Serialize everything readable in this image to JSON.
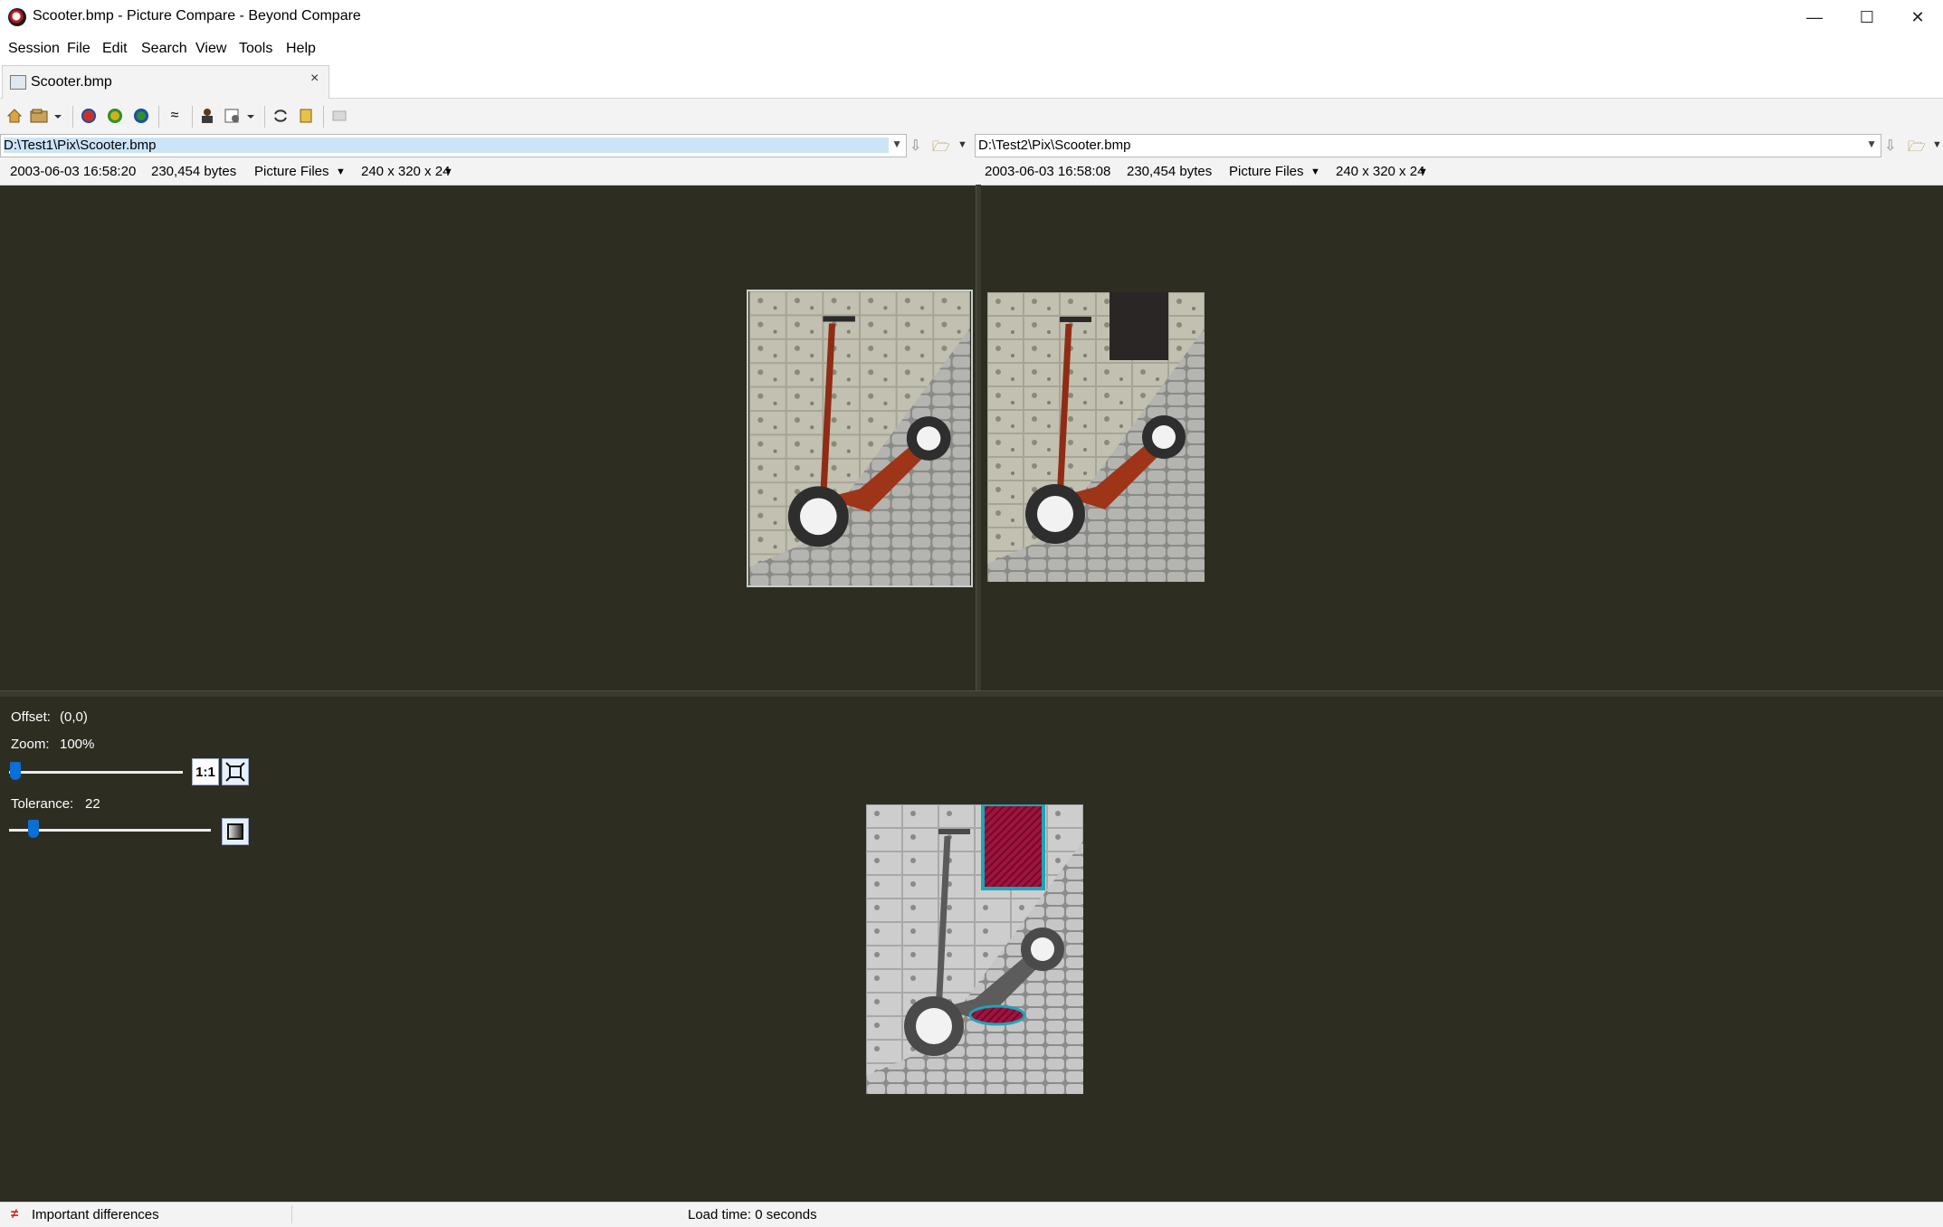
{
  "window": {
    "title": "Scooter.bmp - Picture Compare - Beyond Compare",
    "minimize_glyph": "—",
    "maximize_glyph": "☐",
    "close_glyph": "✕"
  },
  "menu": [
    "Session",
    "File",
    "Edit",
    "Search",
    "View",
    "Tools",
    "Help"
  ],
  "tab": {
    "label": "Scooter.bmp",
    "close_glyph": "×"
  },
  "toolbar": {
    "icons": [
      "home-icon",
      "open-session-icon",
      "show-all-icon",
      "show-differences-icon",
      "show-same-icon",
      "tolerance-icon",
      "rules-icon",
      "options-icon",
      "swap-sides-icon",
      "reload-icon",
      "edit-icon"
    ],
    "approx_glyph": "≈"
  },
  "left": {
    "path": "D:\\Test1\\Pix\\Scooter.bmp",
    "date": "2003-06-03 16:58:20",
    "size": "230,454 bytes",
    "format": "Picture Files",
    "dimensions": "240 x 320 x 24"
  },
  "right": {
    "path": "D:\\Test2\\Pix\\Scooter.bmp",
    "date": "2003-06-03 16:58:08",
    "size": "230,454 bytes",
    "format": "Picture Files",
    "dimensions": "240 x 320 x 24"
  },
  "controls": {
    "offset_label": "Offset:",
    "offset_value": "(0,0)",
    "zoom_label": "Zoom:",
    "zoom_value": "100%",
    "zoom_slider_level": 0.02,
    "one_to_one_label": "1:1",
    "tolerance_label": "Tolerance:",
    "tolerance_value": "22",
    "tolerance_slider_level": 0.1
  },
  "status": {
    "differences": "Important differences",
    "load_time": "Load time: 0 seconds"
  },
  "colors": {
    "pane_background": "#2e2d22",
    "diff_highlight": "#9b0f3a",
    "diff_outline": "#1aa6b7",
    "selection": "#cce4f7"
  }
}
